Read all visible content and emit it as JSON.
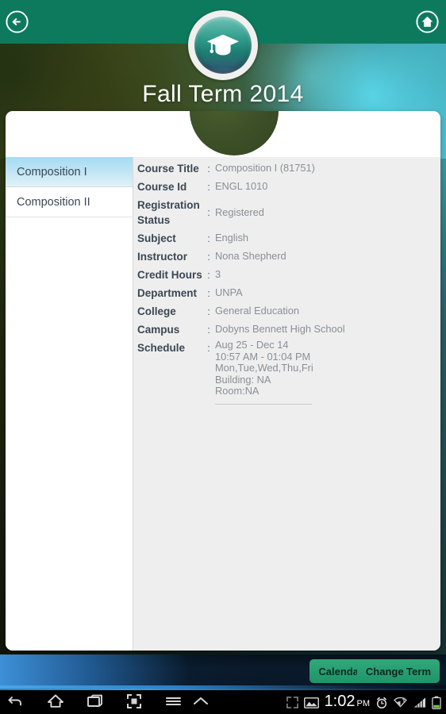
{
  "header": {
    "back_icon": "back-arrow-circle-icon",
    "home_icon": "home-circle-icon",
    "logo_icon": "graduation-cap-icon",
    "accent_color": "#0d7a5e"
  },
  "term_title": "Fall Term 2014",
  "course_list": [
    {
      "label": "Composition I",
      "selected": true
    },
    {
      "label": "Composition II",
      "selected": false
    }
  ],
  "details": {
    "colon": ":",
    "rows": [
      {
        "label": "Course Title",
        "value": "Composition I (81751)"
      },
      {
        "label": "Course Id",
        "value": "ENGL 1010"
      },
      {
        "label": "Registration Status",
        "value": "Registered"
      },
      {
        "label": "Subject",
        "value": "English"
      },
      {
        "label": "Instructor",
        "value": "Nona Shepherd"
      },
      {
        "label": "Credit Hours",
        "value": "3"
      },
      {
        "label": "Department",
        "value": "UNPA"
      },
      {
        "label": "College",
        "value": "General Education"
      },
      {
        "label": "Campus",
        "value": "Dobyns Bennett High School"
      }
    ],
    "schedule": {
      "label": "Schedule",
      "lines": [
        "Aug 25 - Dec 14",
        "10:57 AM - 01:04 PM",
        "Mon,Tue,Wed,Thu,Fri",
        "Building: NA",
        "Room:NA"
      ]
    }
  },
  "action_bar": {
    "calendar_label": "Calendar",
    "change_term_label": "Change Term",
    "button_color": "#2fa97a"
  },
  "system_bar": {
    "nav": [
      "back-icon",
      "home-icon",
      "recents-icon",
      "screenshot-icon",
      "menu-icon",
      "caret-up-icon"
    ],
    "time": "1:02",
    "ampm": "PM",
    "status": [
      "fullscreen-icon",
      "image-icon",
      "alarm-icon",
      "wifi-icon",
      "signal-icon",
      "battery-icon"
    ]
  }
}
